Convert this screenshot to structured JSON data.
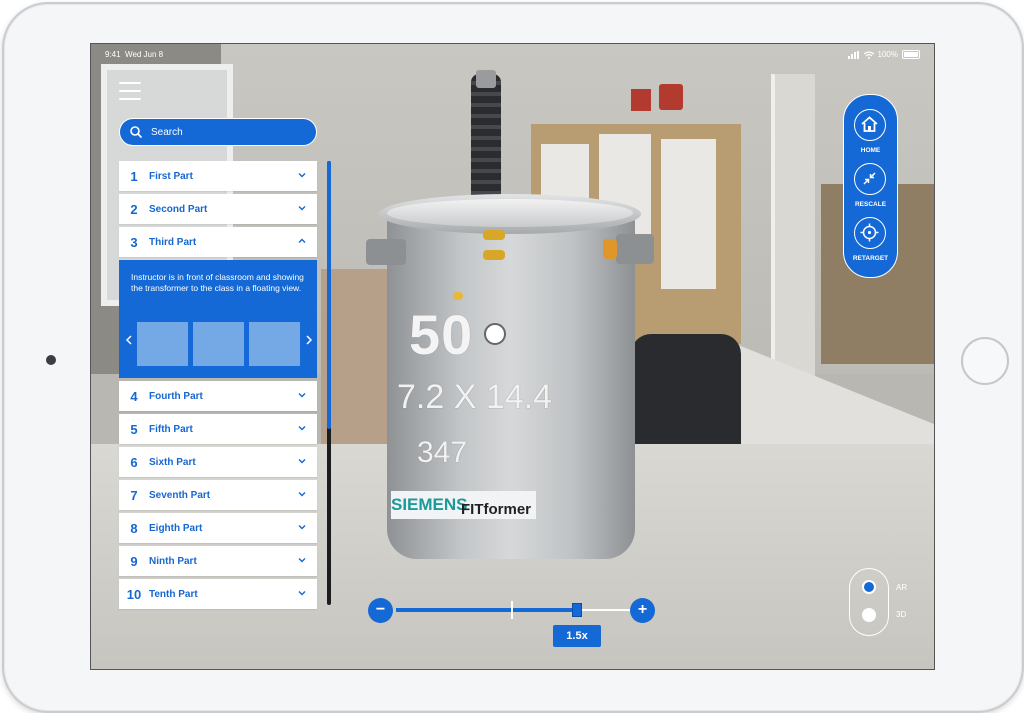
{
  "status_bar": {
    "time": "9:41",
    "date": "Wed Jun 8",
    "battery": "100%"
  },
  "search": {
    "placeholder": "Search"
  },
  "parts": [
    {
      "num": "1",
      "label": "First Part"
    },
    {
      "num": "2",
      "label": "Second Part"
    },
    {
      "num": "3",
      "label": "Third Part",
      "expanded": true,
      "description": "Instructor is in front of classroom and showing the transformer to the class in a floating view."
    },
    {
      "num": "4",
      "label": "Fourth Part"
    },
    {
      "num": "5",
      "label": "Fifth Part"
    },
    {
      "num": "6",
      "label": "Sixth Part"
    },
    {
      "num": "7",
      "label": "Seventh Part"
    },
    {
      "num": "8",
      "label": "Eighth Part"
    },
    {
      "num": "9",
      "label": "Ninth Part"
    },
    {
      "num": "10",
      "label": "Tenth Part"
    }
  ],
  "toolbar": {
    "home": "HOME",
    "rescale": "RESCALE",
    "retarget": "RETARGET"
  },
  "mode_toggle": {
    "ar": "AR",
    "three_d": "3D",
    "selected": "AR"
  },
  "zoom": {
    "minus": "−",
    "plus": "+",
    "value_label": "1.5x",
    "level_fraction": 0.77
  },
  "transformer": {
    "kva": "50",
    "voltage": "7.2 X 14.4",
    "serial": "347",
    "brand": "SIEMENS",
    "model": "FITformer"
  },
  "colors": {
    "accent": "#1469d6",
    "text_blue": "#1667d0",
    "thumb": "#75a9e6"
  }
}
